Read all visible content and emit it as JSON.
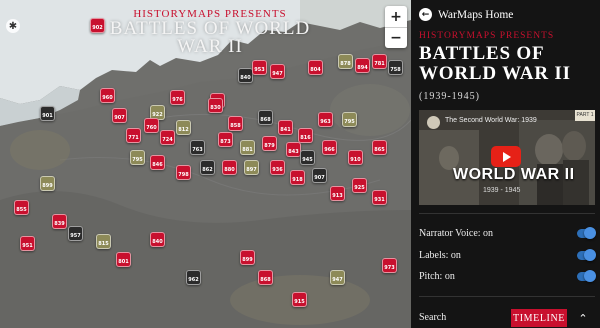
{
  "map": {
    "title_pre": "HISTORYMAPS PRESENTS",
    "title_line1": "BATTLES OF WORLD",
    "title_line2": "WAR II",
    "compass_icon": "compass-icon",
    "zoom_in": "+",
    "zoom_out": "−",
    "markers": [
      "902",
      "960",
      "901",
      "907",
      "922",
      "976",
      "851",
      "840",
      "953",
      "947",
      "804",
      "878",
      "894",
      "781",
      "758",
      "760",
      "812",
      "830",
      "858",
      "868",
      "841",
      "816",
      "963",
      "795",
      "771",
      "724",
      "763",
      "873",
      "881",
      "879",
      "843",
      "945",
      "966",
      "910",
      "865",
      "795",
      "846",
      "798",
      "862",
      "880",
      "897",
      "936",
      "918",
      "907",
      "913",
      "925",
      "931",
      "899",
      "855",
      "839",
      "957",
      "951",
      "815",
      "801",
      "840",
      "962",
      "899",
      "868",
      "915",
      "947",
      "973"
    ]
  },
  "panel": {
    "home_label": "WarMaps Home",
    "title_pre": "HISTORYMAPS PRESENTS",
    "title": "BATTLES OF WORLD WAR II",
    "dates": "(1939-1945)",
    "video": {
      "title": "The Second World War: 1939",
      "part": "PART 1",
      "big": "WORLD WAR II",
      "dates": "1939 - 1945"
    },
    "options": [
      {
        "label": "Narrator Voice: on"
      },
      {
        "label": "Labels: on"
      },
      {
        "label": "Pitch: on"
      }
    ],
    "search_label": "Search",
    "timeline_label": "TIMELINE",
    "collapse_icon": "chevron-up-icon"
  },
  "colors": {
    "accent": "#c8102e",
    "toggle": "#4a90e2",
    "panel_bg": "#141414"
  }
}
